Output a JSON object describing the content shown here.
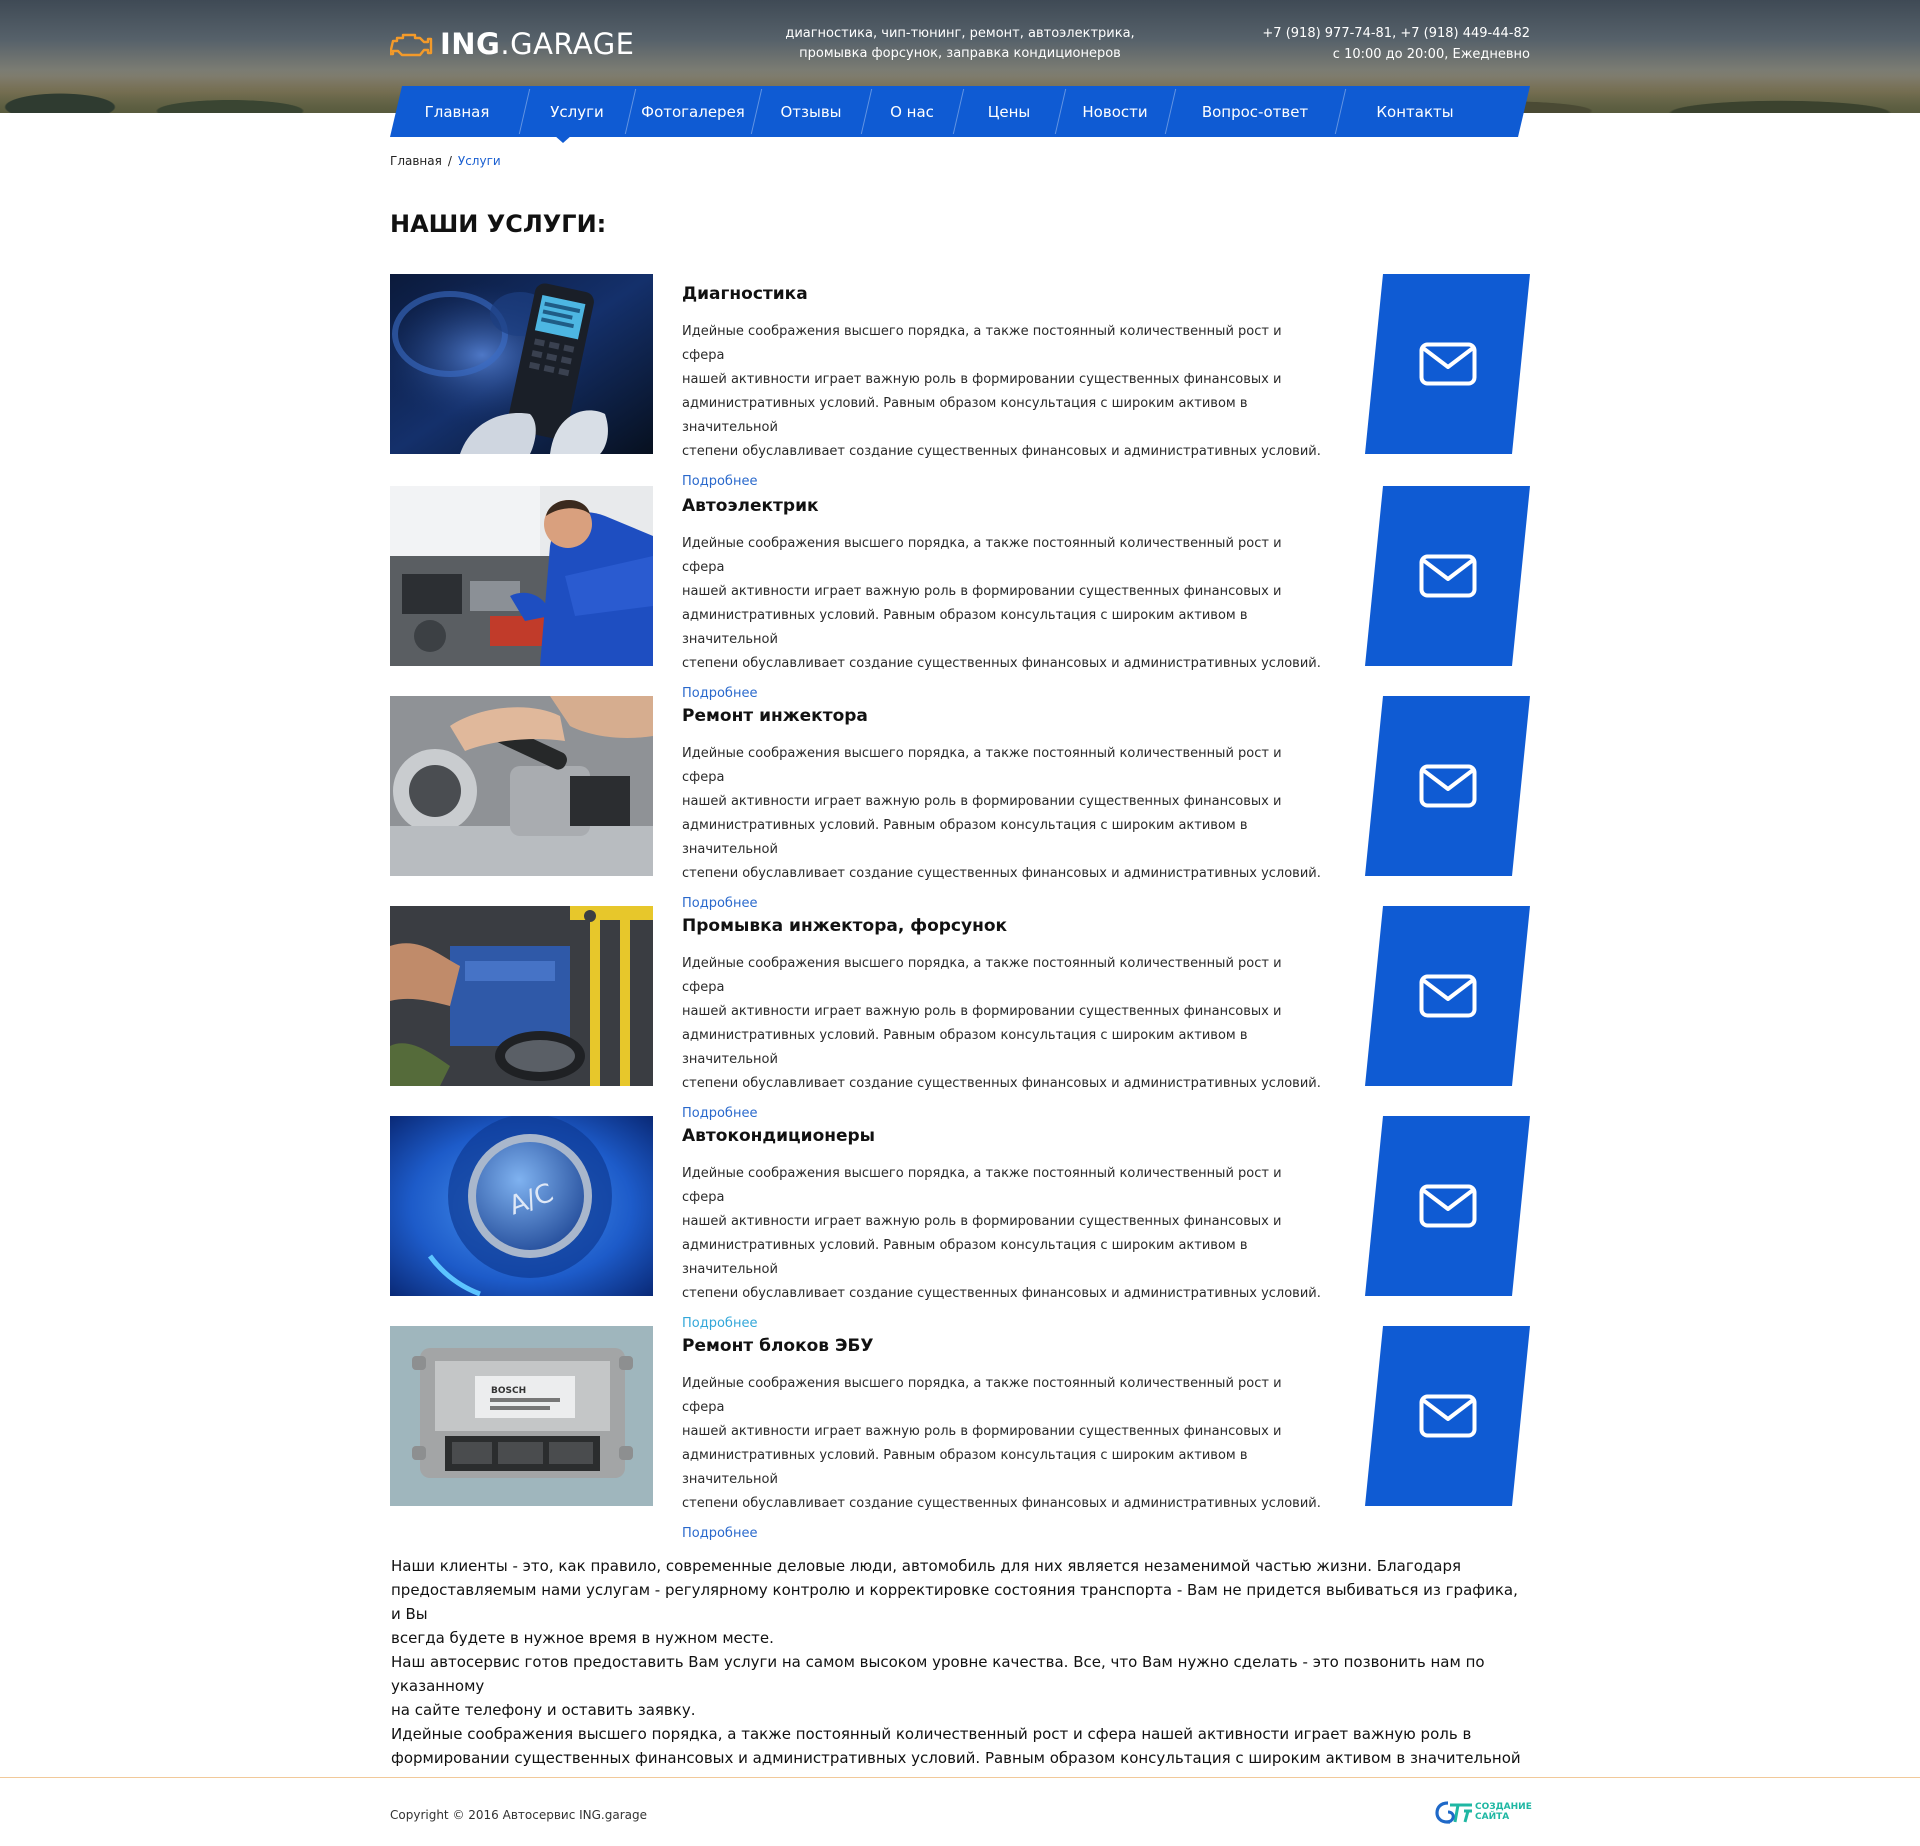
{
  "header": {
    "logo_bold": "ING",
    "logo_thin": ".GARAGE",
    "tagline_line1": "диагностика, чип-тюнинг, ремонт, автоэлектрика,",
    "tagline_line2": "промывка форсунок, заправка кондиционеров",
    "phones": "+7 (918) 977-74-81,  +7 (918) 449-44-82",
    "hours": "с 10:00 до 20:00, Ежедневно"
  },
  "nav": {
    "items": [
      "Главная",
      "Услуги",
      "Фотогалерея",
      "Отзывы",
      "О нас",
      "Цены",
      "Новости",
      "Вопрос-ответ",
      "Контакты"
    ],
    "active": "Услуги"
  },
  "breadcrumb": {
    "home": "Главная",
    "separator": "/",
    "current": "Услуги"
  },
  "page_title": "НАШИ УСЛУГИ:",
  "services": [
    {
      "title": "Диагностика",
      "desc1": "Идейные соображения высшего порядка, а также постоянный количественный рост и сфера",
      "desc2": "нашей активности играет важную роль в формировании существенных финансовых и",
      "desc3": "административных условий. Равным образом консультация с широким активом в значительной",
      "desc4": "степени обуславливает создание существенных финансовых и административных условий.",
      "more": "Подробнее",
      "image_icon": "car-diagnostic-scanner-photo",
      "mail_icon": "envelope-icon"
    },
    {
      "title": "Автоэлектрик",
      "desc1": "Идейные соображения высшего порядка, а также постоянный количественный рост и сфера",
      "desc2": "нашей активности играет важную роль в формировании существенных финансовых и",
      "desc3": "административных условий. Равным образом консультация с широким активом в значительной",
      "desc4": "степени обуславливает создание существенных финансовых и административных условий.",
      "more": "Подробнее",
      "image_icon": "mechanic-under-hood-photo",
      "mail_icon": "envelope-icon"
    },
    {
      "title": "Ремонт инжектора",
      "desc1": "Идейные соображения высшего порядка, а также постоянный количественный рост и сфера",
      "desc2": "нашей активности играет важную роль в формировании существенных финансовых и",
      "desc3": "административных условий. Равным образом консультация с широким активом в значительной",
      "desc4": "степени обуславливает создание существенных финансовых и административных условий.",
      "more": "Подробнее",
      "image_icon": "injector-repair-photo",
      "mail_icon": "envelope-icon"
    },
    {
      "title": "Промывка инжектора, форсунок",
      "desc1": "Идейные соображения высшего порядка, а также постоянный количественный рост и сфера",
      "desc2": "нашей активности играет важную роль в формировании существенных финансовых и",
      "desc3": "административных условий. Равным образом консультация с широким активом в значительной",
      "desc4": "степени обуславливает создание существенных финансовых и административных условий.",
      "more": "Подробнее",
      "image_icon": "engine-bay-photo",
      "mail_icon": "envelope-icon"
    },
    {
      "title": "Автокондиционеры",
      "desc1": "Идейные соображения высшего порядка, а также постоянный количественный рост и сфера",
      "desc2": "нашей активности играет важную роль в формировании существенных финансовых и",
      "desc3": "административных условий. Равным образом консультация с широким активом в значительной",
      "desc4": "степени обуславливает создание существенных финансовых и административных условий.",
      "more": "Подробнее",
      "image_icon": "ac-button-photo",
      "image_label": "A/C",
      "mail_icon": "envelope-icon"
    },
    {
      "title": "Ремонт блоков ЭБУ",
      "desc1": "Идейные соображения высшего порядка, а также постоянный количественный рост и сфера",
      "desc2": "нашей активности играет важную роль в формировании существенных финансовых и",
      "desc3": "административных условий. Равным образом консультация с широким активом в значительной",
      "desc4": "степени обуславливает создание существенных финансовых и административных условий.",
      "more": "Подробнее",
      "image_icon": "ecu-unit-photo",
      "image_label": "BOSCH",
      "mail_icon": "envelope-icon"
    }
  ],
  "about": {
    "line1": "Наши клиенты - это, как правило, современные деловые люди, автомобиль для них является незаменимой частью жизни. Благодаря",
    "line2": "предоставляемым нами услугам - регулярному контролю и корректировке состояния транспорта - Вам не придется выбиваться из графика, и Вы",
    "line3": "всегда будете в нужное время в нужном месте.",
    "line4": "Наш автосервис готов предоставить Вам услуги на самом высоком уровне качества. Все, что Вам нужно сделать - это позвонить нам по указанному",
    "line5": "на сайте телефону и оставить заявку.",
    "line6": "Идейные соображения высшего порядка, а также постоянный количественный рост и сфера нашей активности играет важную роль в",
    "line7": "формировании существенных финансовых и административных условий. Равным образом консультация с широким активом в значительной"
  },
  "footer": {
    "copyright": "Copyright © 2016 Автосервис ING.garage",
    "studio_line1": "СОЗДАНИЕ",
    "studio_line2": "САЙТА"
  },
  "colors": {
    "brand_blue": "#0f5bd3",
    "link_blue": "#2a69cc",
    "logo_orange": "#f39a2a",
    "footer_line": "#f1c99a",
    "studio_green": "#1fb7a3"
  }
}
